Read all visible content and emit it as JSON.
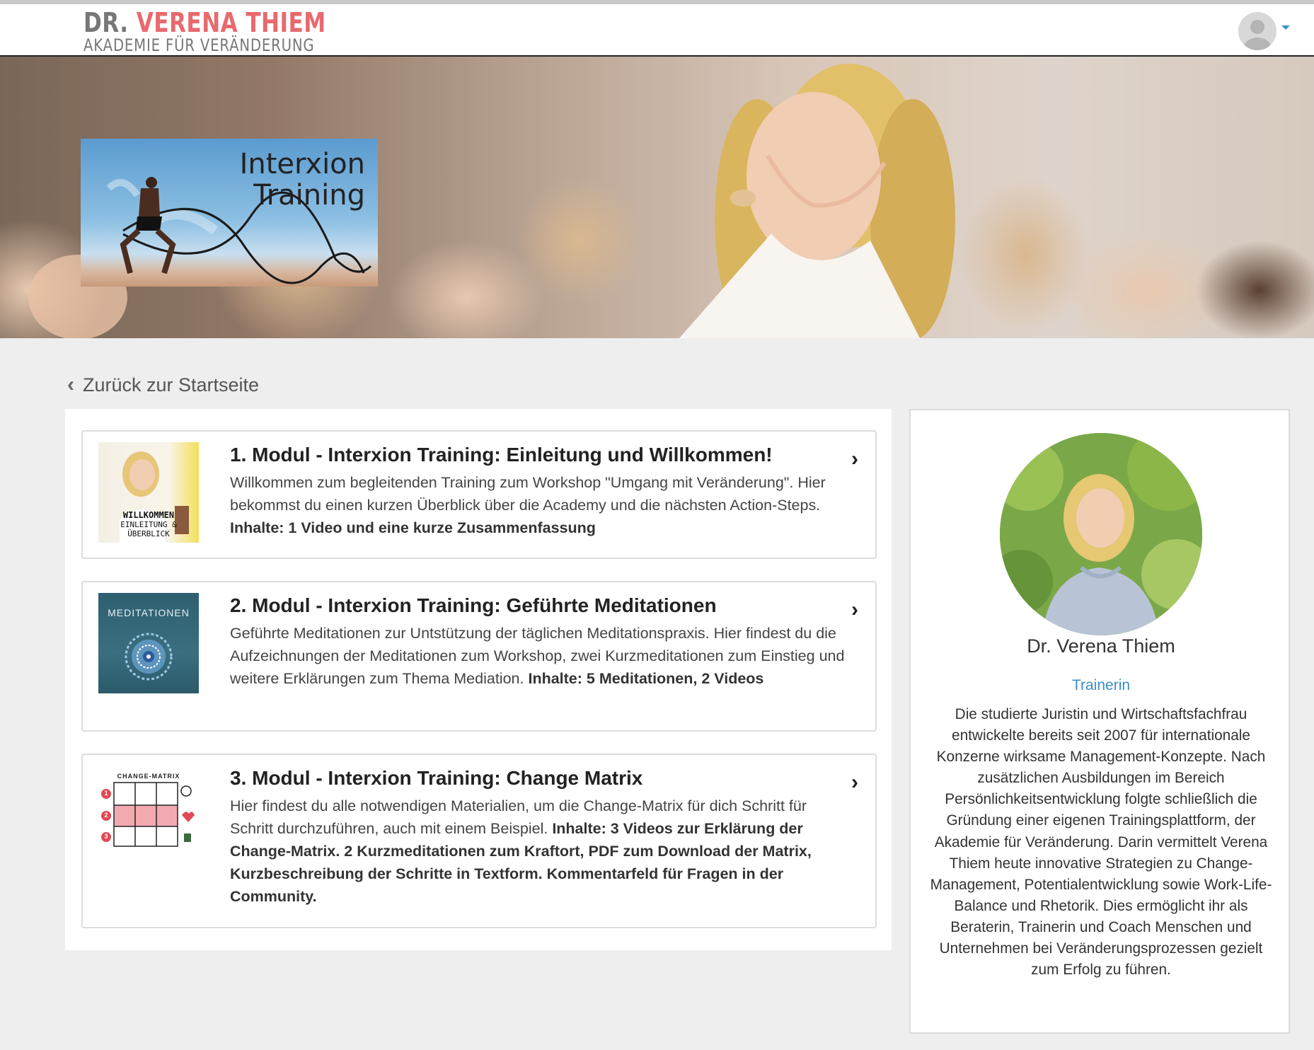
{
  "header": {
    "logo_dr": "DR.",
    "logo_name": "VERENA THIEM",
    "logo_subtitle": "AKADEMIE FÜR VERÄNDERUNG",
    "accent_color": "#e8696e"
  },
  "course": {
    "title_line1": "Interxion",
    "title_line2": "Training"
  },
  "nav": {
    "back_label": "Zurück zur Startseite"
  },
  "modules": [
    {
      "title": "1. Modul - Interxion Training: Einleitung und Willkommen!",
      "description": "Willkommen zum begleitenden Training zum Workshop \"Umgang mit Veränderung\". Hier bekommst du einen kurzen Überblick über die Academy und die nächsten Action-Steps.",
      "contents": "Inhalte: 1 Video und eine kurze Zusammenfassung",
      "thumb_line1": "WILLKOMMEN",
      "thumb_line2": "EINLEITUNG &",
      "thumb_line3": "ÜBERBLICK"
    },
    {
      "title": "2. Modul - Interxion Training: Geführte Meditationen",
      "description": "Geführte Meditationen zur Untstützung der täglichen Meditationspraxis. Hier findest du die Aufzeichnungen der Meditationen zum Workshop, zwei Kurzmeditationen zum Einstieg und weitere Erklärungen zum Thema Mediation.",
      "contents": "Inhalte: 5 Meditationen, 2 Videos",
      "thumb_label": "MEDITATIONEN"
    },
    {
      "title": "3. Modul - Interxion Training: Change Matrix",
      "description": "Hier findest du alle notwendigen Materialien, um die Change-Matrix für dich Schritt für Schritt durchzuführen, auch mit einem Beispiel.",
      "contents": "Inhalte: 3 Videos zur Erklärung der Change-Matrix. 2 Kurzmeditationen zum Kraftort, PDF zum Download der Matrix, Kurzbeschreibung der Schritte in Textform. Kommentarfeld für Fragen in der Community.",
      "thumb_label": "CHANGE-MATRIX",
      "thumb_n1": "1",
      "thumb_n2": "2",
      "thumb_n3": "3"
    }
  ],
  "trainer": {
    "name": "Dr. Verena Thiem",
    "role": "Trainerin",
    "bio": "Die studierte Juristin und Wirtschaftsfachfrau entwickelte bereits seit 2007 für internationale Konzerne wirksame Management-Konzepte. Nach zusätzlichen Ausbildungen im Bereich Persönlichkeitsentwicklung folgte schließlich die Gründung einer eigenen Trainingsplattform, der Akademie für Veränderung. Darin vermittelt Verena Thiem heute innovative Strategien zu Change-Management, Potentialentwicklung sowie Work-Life-Balance und Rhetorik. Dies ermöglicht ihr als Beraterin, Trainerin und Coach Menschen und Unternehmen bei Veränderungsprozessen gezielt zum Erfolg zu führen."
  }
}
